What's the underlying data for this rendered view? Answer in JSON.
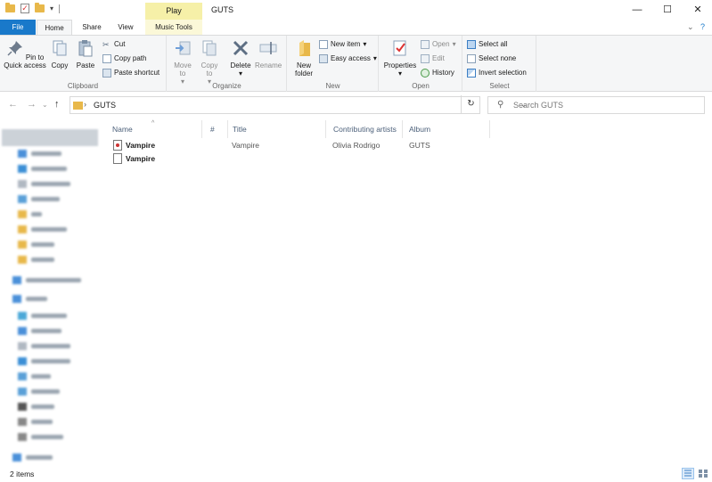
{
  "window": {
    "title": "GUTS",
    "contextual_tab_group": "Play",
    "minimize": "—",
    "maximize": "☐",
    "close": "✕"
  },
  "tabs": {
    "file": "File",
    "home": "Home",
    "share": "Share",
    "view": "View",
    "music_tools": "Music Tools"
  },
  "ribbon": {
    "clipboard": {
      "label": "Clipboard",
      "pin": "Pin to Quick access",
      "copy": "Copy",
      "paste": "Paste",
      "cut": "Cut",
      "copy_path": "Copy path",
      "paste_shortcut": "Paste shortcut"
    },
    "organize": {
      "label": "Organize",
      "move_to": "Move to",
      "copy_to": "Copy to",
      "delete": "Delete",
      "rename": "Rename"
    },
    "new": {
      "label": "New",
      "new_folder": "New folder",
      "new_item": "New item",
      "easy_access": "Easy access"
    },
    "open": {
      "label": "Open",
      "properties": "Properties",
      "open": "Open",
      "edit": "Edit",
      "history": "History"
    },
    "select": {
      "label": "Select",
      "select_all": "Select all",
      "select_none": "Select none",
      "invert_selection": "Invert selection"
    }
  },
  "address": {
    "path": "GUTS",
    "search_placeholder": "Search GUTS"
  },
  "columns": {
    "name": "Name",
    "number": "#",
    "title": "Title",
    "artists": "Contributing artists",
    "album": "Album"
  },
  "files": [
    {
      "name": "Vampire",
      "number": "",
      "title": "Vampire",
      "artists": "Olivia Rodrigo",
      "album": "GUTS",
      "type": "audio"
    },
    {
      "name": "Vampire",
      "number": "",
      "title": "",
      "artists": "",
      "album": "",
      "type": "document"
    }
  ],
  "status": {
    "item_count": "2 items"
  },
  "colors": {
    "file_tab": "#1979ca",
    "play_tab": "#f6f0a8",
    "folder": "#e8b84a",
    "column_header_text": "#4c607a"
  }
}
